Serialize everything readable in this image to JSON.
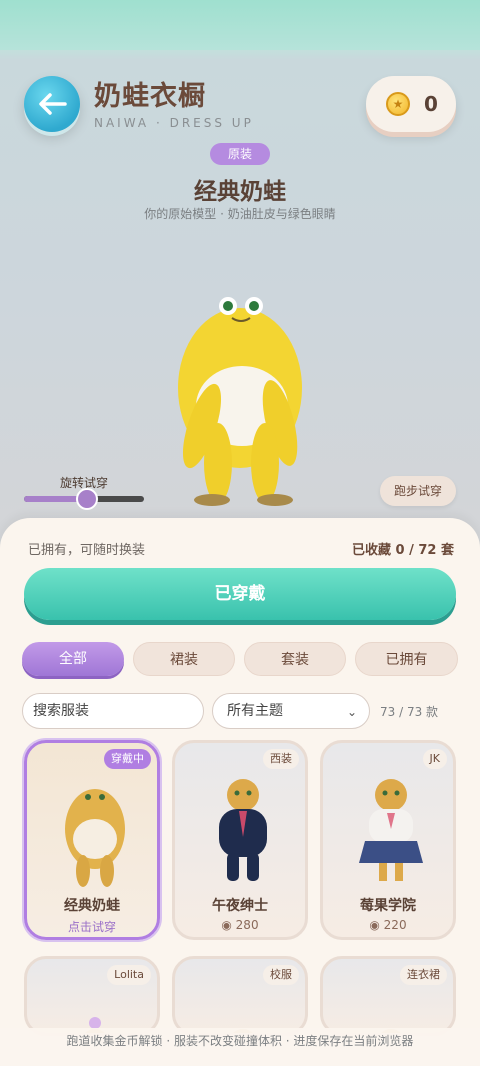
{
  "header": {
    "title": "奶蛙衣橱",
    "subtitle": "NAIWA · DRESS UP",
    "coins": "0"
  },
  "hero": {
    "tag": "原装",
    "name": "经典奶蛙",
    "desc": "你的原始模型 · 奶油肚皮与绿色眼睛",
    "rotate_label": "旋转试穿",
    "rotate_value": 0.5,
    "run_button": "跑步试穿"
  },
  "panel": {
    "owned_text": "已拥有，可随时换装",
    "collected": "已收藏 0 / 72 套",
    "wear_button": "已穿戴"
  },
  "filters": [
    "全部",
    "裙装",
    "套装",
    "已拥有"
  ],
  "search": {
    "placeholder": "搜索服装"
  },
  "theme_select": "所有主题",
  "count": "73 / 73 款",
  "cards": [
    {
      "badge": "穿戴中",
      "name": "经典奶蛙",
      "sub": "点击试穿"
    },
    {
      "badge": "西装",
      "name": "午夜绅士",
      "sub": "◉ 280"
    },
    {
      "badge": "JK",
      "name": "莓果学院",
      "sub": "◉ 220"
    },
    {
      "badge": "Lolita"
    },
    {
      "badge": "校服"
    },
    {
      "badge": "连衣裙"
    }
  ],
  "footer": "跑道收集金币解锁 · 服装不改变碰撞体积 · 进度保存在当前浏览器",
  "colors": {
    "accent": "#a780c9",
    "primary_button": "#39c2ad",
    "coin": "#f2b529"
  }
}
